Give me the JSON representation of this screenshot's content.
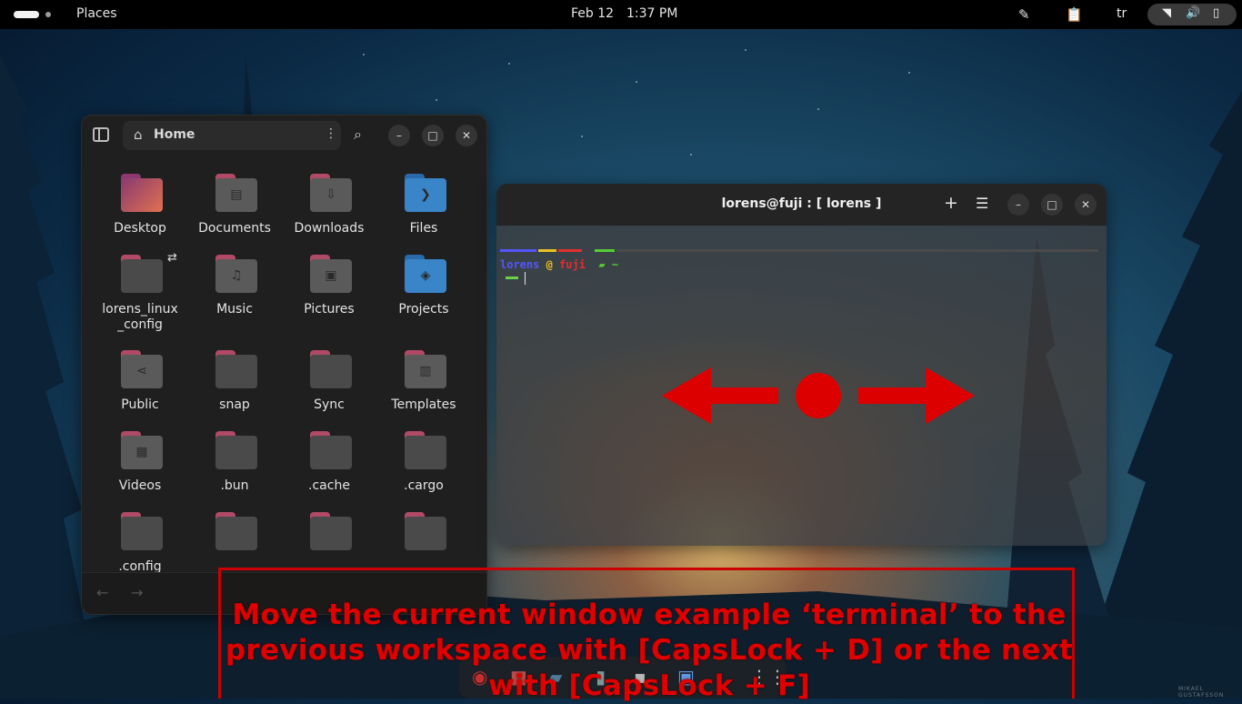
{
  "topbar": {
    "places_label": "Places",
    "date": "Feb 12",
    "time": "1:37 PM",
    "language": "tr",
    "icons": [
      "color-picker-icon",
      "clipboard-icon",
      "wifi-icon",
      "volume-icon",
      "battery-icon"
    ]
  },
  "files": {
    "path_label": "Home",
    "items": [
      {
        "label": "Desktop",
        "kind": "desktop"
      },
      {
        "label": "Documents",
        "kind": "documents"
      },
      {
        "label": "Downloads",
        "kind": "downloads"
      },
      {
        "label": "Files",
        "kind": "files"
      },
      {
        "label": "lorens_linux\n_config",
        "kind": "config"
      },
      {
        "label": "Music",
        "kind": "music"
      },
      {
        "label": "Pictures",
        "kind": "pictures"
      },
      {
        "label": "Projects",
        "kind": "projects"
      },
      {
        "label": "Public",
        "kind": "public"
      },
      {
        "label": "snap",
        "kind": "folder"
      },
      {
        "label": "Sync",
        "kind": "folder"
      },
      {
        "label": "Templates",
        "kind": "templates"
      },
      {
        "label": "Videos",
        "kind": "videos"
      },
      {
        "label": ".bun",
        "kind": "folder"
      },
      {
        "label": ".cache",
        "kind": "folder"
      },
      {
        "label": ".cargo",
        "kind": "folder"
      },
      {
        "label": ".config",
        "kind": "folder"
      },
      {
        "label": "",
        "kind": "folder"
      },
      {
        "label": "",
        "kind": "folder"
      },
      {
        "label": "",
        "kind": "folder"
      }
    ]
  },
  "terminal": {
    "title": "lorens@fuji : [ lorens ]",
    "prompt_user": "lorens",
    "prompt_at": " @ ",
    "prompt_host": "fuji",
    "prompt_dir": " ~",
    "colors": {
      "user": "#5555ff",
      "at": "#e8c020",
      "host": "#e03030",
      "dir": "#55cc33"
    }
  },
  "caption": {
    "text": "Move the current window example ‘terminal’ to the\nprevious workspace with [CapsLock + D] or the next\nwith [CapsLock + F]",
    "color": "#e00000"
  },
  "wallpaper_credit": "MIKAEL GUSTAFSSON"
}
